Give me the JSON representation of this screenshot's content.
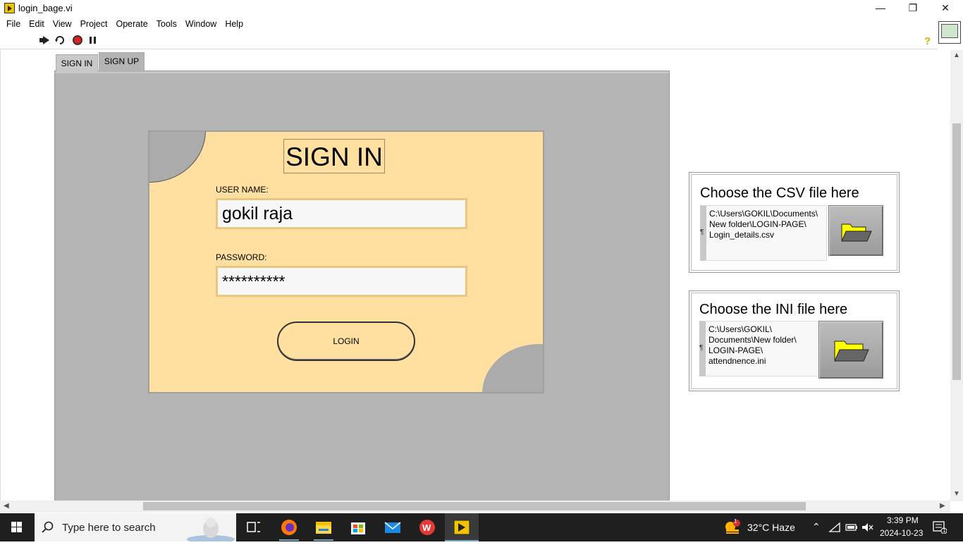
{
  "window": {
    "title": "login_bage.vi"
  },
  "menu": [
    "File",
    "Edit",
    "View",
    "Project",
    "Operate",
    "Tools",
    "Window",
    "Help"
  ],
  "tabs": [
    {
      "label": "SIGN IN"
    },
    {
      "label": "SIGN UP"
    }
  ],
  "signin": {
    "heading": "SIGN IN",
    "username_label": "USER NAME:",
    "username_value": "gokil raja",
    "password_label": "PASSWORD:",
    "password_value": "**********",
    "login_label": "LOGIN"
  },
  "csv_picker": {
    "label": "Choose the CSV file here",
    "path": "C:\\Users\\GOKIL\\Documents\\\nNew folder\\LOGIN-PAGE\\\nLogin_details.csv"
  },
  "ini_picker": {
    "label": "Choose the INI  file here",
    "path": "C:\\Users\\GOKIL\\\nDocuments\\New folder\\\nLOGIN-PAGE\\\nattendnence.ini"
  },
  "taskbar": {
    "search_placeholder": "Type here to search",
    "weather": "32°C  Haze",
    "weather_badge": "1",
    "time": "3:39 PM",
    "date": "2024-10-23",
    "notification_count": "1"
  },
  "colors": {
    "card_bg": "#ffe0a0",
    "panel_bg": "#b4b4b4",
    "folder_yellow": "#ffff00"
  }
}
